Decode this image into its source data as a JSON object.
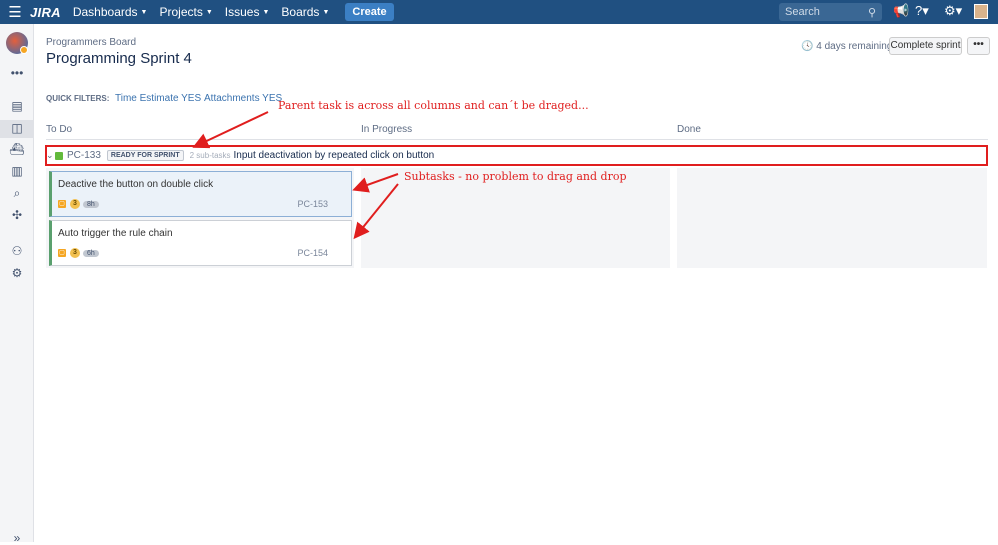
{
  "topnav": {
    "logo": "JIRA",
    "menus": [
      "Dashboards",
      "Projects",
      "Issues",
      "Boards"
    ],
    "create_label": "Create",
    "search_placeholder": "Search"
  },
  "header": {
    "breadcrumb": "Programmers Board",
    "title": "Programming Sprint 4",
    "remaining": "4 days remaining",
    "complete_label": "Complete sprint",
    "more_label": "•••"
  },
  "quick_filters": {
    "label": "QUICK FILTERS:",
    "filters": [
      "Time Estimate YES",
      "Attachments YES"
    ]
  },
  "columns": [
    "To Do",
    "In Progress",
    "Done"
  ],
  "parent": {
    "key": "PC-133",
    "status": "READY FOR SPRINT",
    "subtasks": "2 sub-tasks",
    "title": "Input deactivation by repeated click on button"
  },
  "cards": [
    {
      "title": "Deactive the button on double click",
      "priority": "3",
      "estimate": "8h",
      "key": "PC-153"
    },
    {
      "title": "Auto trigger the rule chain",
      "priority": "3",
      "estimate": "6h",
      "key": "PC-154"
    }
  ],
  "annotations": {
    "parent_note": "Parent task is across all columns and can´t be draged...",
    "subtask_note": "Subtasks - no problem to drag and drop"
  },
  "colors": {
    "nav": "#205081",
    "annotation": "#e01e1e",
    "link": "#3b73af"
  }
}
